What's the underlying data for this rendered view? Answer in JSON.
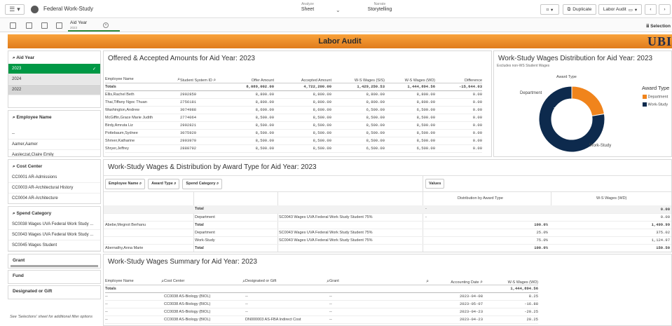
{
  "toolbar": {
    "app_title": "Federal Work-Study",
    "analyze_small": "Analyze",
    "analyze_big": "Sheet",
    "narrate_small": "Narrate",
    "narrate_big": "Storytelling",
    "duplicate": "Duplicate",
    "sheet_name": "Labor Audit",
    "selections": "Selection"
  },
  "selection_chip": {
    "label": "Aid Year",
    "value": "2023"
  },
  "banner": {
    "title": "Labor Audit",
    "logo": "UBI"
  },
  "filters": {
    "aid_year": {
      "title": "Aid Year",
      "items": [
        "2023",
        "2024",
        "2022"
      ]
    },
    "employee_name": {
      "title": "Employee Name",
      "items": [
        "--",
        "Aamer,Aamer",
        "Aasleczat,Claire Emily"
      ]
    },
    "cost_center": {
      "title": "Cost Center",
      "items": [
        "CC0001 AR-Admissions",
        "CC0003 AR-Architectural History",
        "CC0004 AR-Architecture"
      ]
    },
    "spend_category": {
      "title": "Spend Category",
      "items": [
        "SC0038 Wages UVA Federal Work Study ...",
        "SC0043 Wages UVA Federal Work Study ...",
        "SC0045 Wages Student"
      ]
    },
    "grant": "Grant",
    "fund": "Fund",
    "designated": "Designated or Gift",
    "note": "See 'Selections' sheet for additional filter options"
  },
  "offered": {
    "title": "Offered & Accepted Amounts for Aid Year: 2023",
    "headers": [
      "Employee Name",
      "Student System ID",
      "Offer Amount",
      "Accepted Amount",
      "W-S Wages (SIS)",
      "W-S Wages (WD)",
      "Difference"
    ],
    "totals": [
      "Totals",
      "",
      "8,089,002.00",
      "4,722,200.00",
      "1,429,250.53",
      "1,444,894.56",
      "-15,644.03"
    ],
    "rows": [
      [
        "Ellis,Rachel Beth",
        "2992859",
        "8,800.00",
        "8,800.00",
        "8,800.00",
        "8,800.00",
        "0.00"
      ],
      [
        "Thai,Tiffany Ngoc Thuan",
        "2756181",
        "8,800.00",
        "8,800.00",
        "8,800.00",
        "8,800.00",
        "0.00"
      ],
      [
        "Washington,Andrew",
        "3074988",
        "8,600.00",
        "8,600.00",
        "6,509.00",
        "6,509.00",
        "0.00"
      ],
      [
        "McGiffin,Grace Marie Judith",
        "2774064",
        "8,500.00",
        "8,500.00",
        "8,500.00",
        "8,500.00",
        "0.00"
      ],
      [
        "Birdy,Amruta Liz",
        "2992821",
        "8,500.00",
        "8,500.00",
        "8,500.00",
        "8,500.00",
        "0.00"
      ],
      [
        "Pottebaum,Sydnee",
        "3075920",
        "8,500.00",
        "8,500.00",
        "8,500.00",
        "8,500.00",
        "0.00"
      ],
      [
        "Shriver,Katharine",
        "2993970",
        "8,500.00",
        "8,500.00",
        "8,500.00",
        "8,500.00",
        "0.00"
      ],
      [
        "Shryer,Jeffrey",
        "2880792",
        "8,500.00",
        "8,500.00",
        "6,500.00",
        "6,500.00",
        "0.00"
      ]
    ]
  },
  "donut": {
    "title": "Work-Study Wages Distribution for Aid Year: 2023",
    "subtitle": "Excludes non-WS Student Wages",
    "center_label": "Award Type",
    "legend_title": "Award Type",
    "labels": {
      "department": "Department",
      "work_study": "Work-Study",
      "pct_department": "22.6%",
      "pct_work_study": "78.0%"
    },
    "legend": [
      "Department",
      "Work-Study"
    ],
    "colors": {
      "department": "#f0841c",
      "work_study": "#0d2a4d"
    }
  },
  "chart_data": {
    "type": "pie",
    "title": "Work-Study Wages Distribution for Aid Year: 2023",
    "categories": [
      "Department",
      "Work-Study"
    ],
    "values": [
      22.6,
      78.0
    ]
  },
  "award": {
    "title": "Work-Study Wages & Distribution by Award Type for Aid Year: 2023",
    "chips": [
      "Employee Name",
      "Award Type",
      "Spend Category"
    ],
    "values_chip": "Values",
    "col_dist": "Distribution by Award Type",
    "col_wages": "W-S Wages (WD)",
    "rows": [
      [
        "",
        "Total",
        "",
        "-",
        "",
        "0.00"
      ],
      [
        "",
        "Department",
        "SC0043 Wages UVA Federal Work Study Student 75%",
        "-",
        "",
        "0.00"
      ],
      [
        "Abebe,Megnot Berhanu",
        "Total",
        "",
        "",
        "100.0%",
        "1,499.99"
      ],
      [
        "",
        "Department",
        "SC0043 Wages UVA Federal Work Study Student 75%",
        "",
        "25.0%",
        "375.02"
      ],
      [
        "",
        "Work-Study",
        "SC0043 Wages UVA Federal Work Study Student 75%",
        "",
        "75.0%",
        "1,124.97"
      ],
      [
        "Abernathy,Anna Marie",
        "Total",
        "",
        "",
        "100.0%",
        "150.50"
      ]
    ]
  },
  "summary": {
    "title": "Work-Study Wages Summary for Aid Year: 2023",
    "headers": [
      "Employee Name",
      "Cost Center",
      "Designated or Gift",
      "Grant",
      "Accounting Date",
      "W-S Wages (WD)"
    ],
    "totals": [
      "Totals",
      "",
      "",
      "",
      "",
      "1,444,894.56"
    ],
    "rows": [
      [
        "--",
        "CC0038 AS-Biology (BIOL)",
        "--",
        "--",
        "2023-04-08",
        "8.25"
      ],
      [
        "--",
        "CC0038 AS-Biology (BIOL)",
        "--",
        "--",
        "2023-05-07",
        "-16.88"
      ],
      [
        "--",
        "CC0038 AS-Biology (BIOL)",
        "--",
        "--",
        "2023-04-23",
        "-20.25"
      ],
      [
        "--",
        "CC0038 AS-Biology (BIOL)",
        "DN000003 AS-FBA Indirect Cost",
        "--",
        "2023-04-23",
        "20.25"
      ]
    ]
  }
}
